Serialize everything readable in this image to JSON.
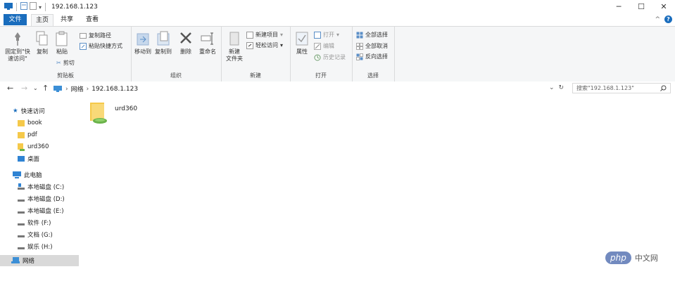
{
  "title_bar": {
    "path": "192.168.1.123",
    "minimize": "─",
    "maximize": "☐",
    "close": "✕"
  },
  "tabs": [
    "文件",
    "主页",
    "共享",
    "查看"
  ],
  "ribbon": {
    "clipboard": {
      "pin": "固定到\"快\n速访问\"",
      "copy": "复制",
      "paste": "粘贴",
      "copy_path": "复制路径",
      "paste_shortcut": "粘贴快捷方式",
      "cut": "剪切",
      "label": "剪贴板"
    },
    "organize": {
      "move_to": "移动到",
      "copy_to": "复制到",
      "delete": "删除",
      "rename": "重命名",
      "label": "组织"
    },
    "new": {
      "new_folder": "新建\n文件夹",
      "new_item": "新建项目",
      "easy_access": "轻松访问",
      "label": "新建"
    },
    "open": {
      "properties": "属性",
      "open": "打开",
      "edit": "编辑",
      "history": "历史记录",
      "label": "打开"
    },
    "select": {
      "select_all": "全部选择",
      "select_none": "全部取消",
      "invert": "反向选择",
      "label": "选择"
    }
  },
  "address": {
    "segments": [
      "网络",
      "192.168.1.123"
    ],
    "search_placeholder": "搜索\"192.168.1.123\""
  },
  "nav_pane": {
    "quick_access": "快速访问",
    "quick_items": [
      "book",
      "pdf",
      "urd360",
      "桌面"
    ],
    "this_pc": "此电脑",
    "drives": [
      "本地磁盘 (C:)",
      "本地磁盘 (D:)",
      "本地磁盘 (E:)",
      "软件 (F:)",
      "文档 (G:)",
      "娱乐 (H:)"
    ],
    "network": "网络"
  },
  "content": {
    "items": [
      {
        "name": "urd360"
      }
    ]
  },
  "watermark": {
    "logo": "php",
    "text": "中文网"
  }
}
